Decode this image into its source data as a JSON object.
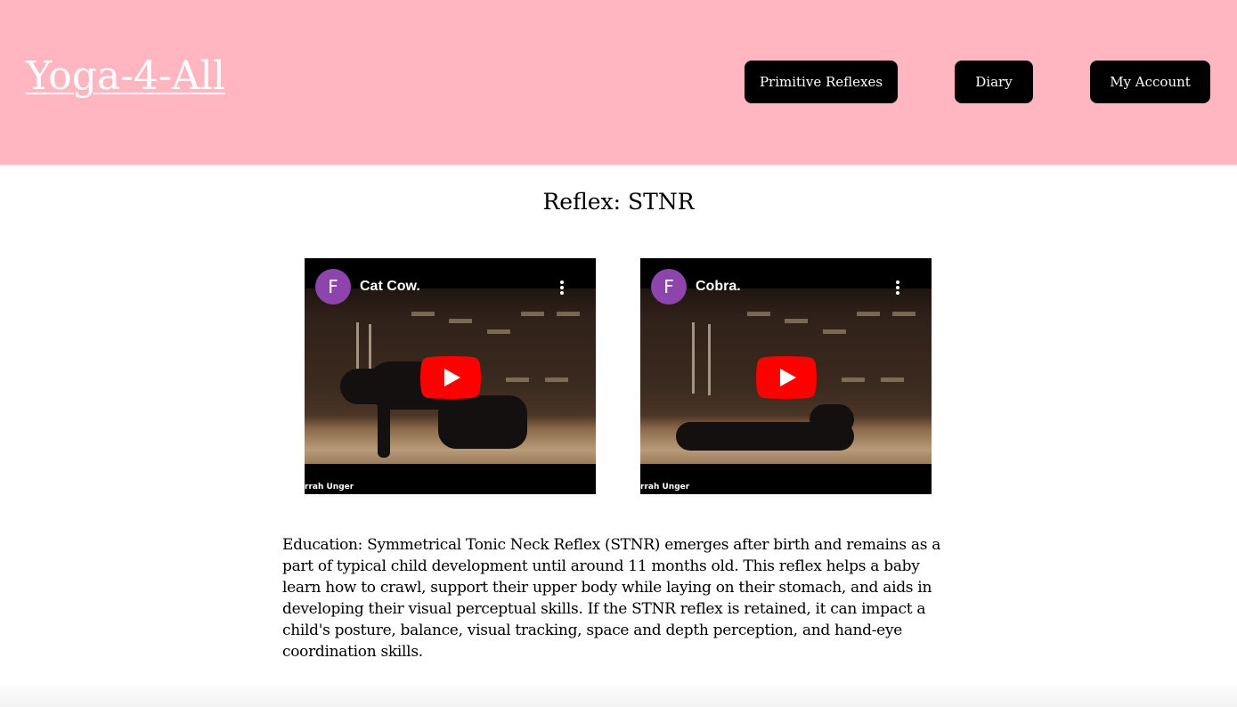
{
  "header": {
    "logo": "Yoga-4-All",
    "nav": {
      "primitive_reflexes": "Primitive Reflexes",
      "diary": "Diary",
      "my_account": "My Account"
    },
    "background_color": "#ffb6c1"
  },
  "main": {
    "title": "Reflex: STNR",
    "videos": [
      {
        "title": "Cat Cow.",
        "channel_initial": "F",
        "credit": "rrah Unger"
      },
      {
        "title": "Cobra.",
        "channel_initial": "F",
        "credit": "rrah Unger"
      }
    ],
    "education": "Education: Symmetrical Tonic Neck Reflex (STNR) emerges after birth and remains as a part of typical child development until around 11 months old. This reflex helps a baby learn how to crawl, support their upper body while laying on their stomach, and aids in developing their visual perceptual skills. If the STNR reflex is retained, it can impact a child's posture, balance, visual tracking, space and depth perception, and hand-eye coordination skills."
  },
  "colors": {
    "avatar": "#8e44ad",
    "play_button": "#ff0000"
  },
  "icons": [
    "play-icon",
    "more-vert-icon",
    "channel-avatar"
  ]
}
